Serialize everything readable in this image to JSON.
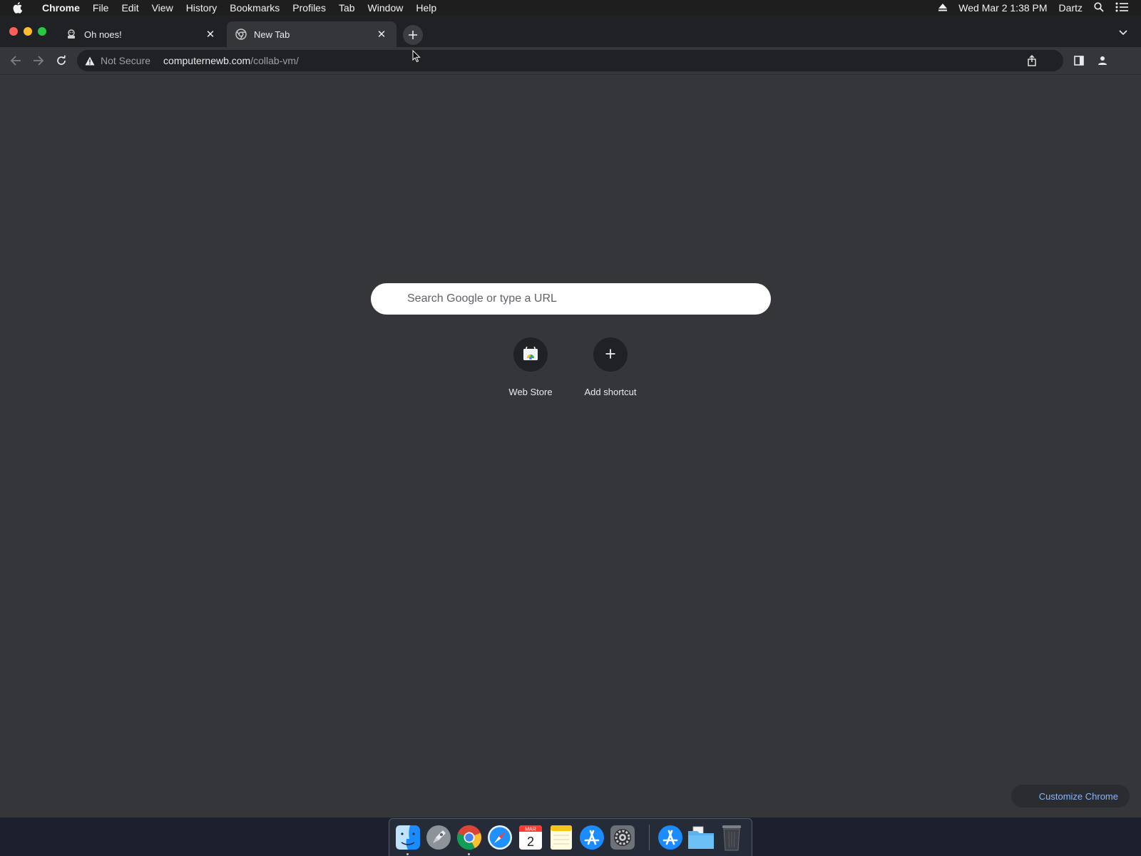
{
  "menubar": {
    "app_name": "Chrome",
    "items": [
      "File",
      "Edit",
      "View",
      "History",
      "Bookmarks",
      "Profiles",
      "Tab",
      "Window",
      "Help"
    ],
    "datetime": "Wed Mar 2  1:38 PM",
    "user": "Dartz"
  },
  "tabs": [
    {
      "title": "Oh noes!",
      "active": false,
      "favicon": "collabvm-icon"
    },
    {
      "title": "New Tab",
      "active": true,
      "favicon": "chrome-icon"
    }
  ],
  "omnibox": {
    "security_label": "Not Secure",
    "url_host": "computernewb.com",
    "url_path": "/collab-vm/"
  },
  "ntp": {
    "search_placeholder": "Search Google or type a URL",
    "shortcuts": [
      {
        "label": "Web Store",
        "icon": "web-store-icon"
      },
      {
        "label": "Add shortcut",
        "icon": "plus-icon"
      }
    ],
    "customize_label": "Customize Chrome"
  },
  "dock": {
    "calendar_month": "MAR",
    "calendar_day": "2",
    "apps": [
      "finder",
      "launchpad",
      "chrome",
      "safari",
      "calendar",
      "notes",
      "app-store",
      "system-preferences",
      "app-store-downloads",
      "documents-folder",
      "trash"
    ]
  },
  "colors": {
    "accent_link": "#8ab4f8",
    "page_bg": "#35363a",
    "tabstrip_bg": "#202124"
  }
}
